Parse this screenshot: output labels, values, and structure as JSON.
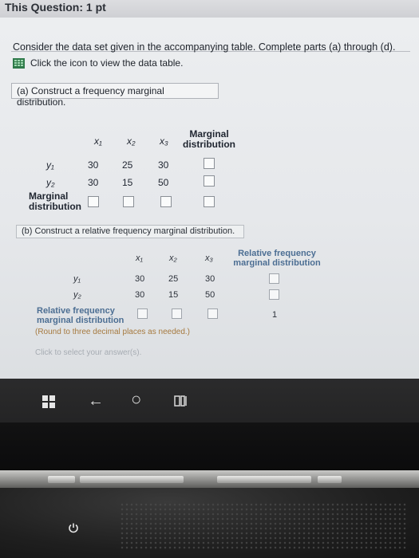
{
  "header": {
    "question_label": "This Question: 1 pt"
  },
  "intro": {
    "text": "Consider the data set given in the accompanying table. Complete parts (a) through (d).",
    "table_link": "Click the icon to view the data table."
  },
  "part_a": {
    "title": "(a) Construct a frequency marginal distribution.",
    "columns": [
      "x₁",
      "x₂",
      "x₃"
    ],
    "marginal_header_1": "Marginal",
    "marginal_header_2": "distribution",
    "rows": [
      {
        "label": "y₁",
        "values": [
          "30",
          "25",
          "30"
        ]
      },
      {
        "label": "y₂",
        "values": [
          "30",
          "15",
          "50"
        ]
      }
    ],
    "marginal_row_1": "Marginal",
    "marginal_row_2": "distribution"
  },
  "part_b": {
    "title": "(b) Construct a relative frequency marginal distribution.",
    "columns": [
      "x₁",
      "x₂",
      "x₃"
    ],
    "rf_header_1": "Relative frequency",
    "rf_header_2": "marginal distribution",
    "rows": [
      {
        "label": "y₁",
        "values": [
          "30",
          "25",
          "30"
        ]
      },
      {
        "label": "y₂",
        "values": [
          "30",
          "15",
          "50"
        ]
      }
    ],
    "rf_row_1": "Relative frequency",
    "rf_row_2": "marginal distribution",
    "total": "1",
    "round_note": "(Round to three decimal places as needed.)",
    "answer_prompt": "Click to select your answer(s)."
  },
  "taskbar": {
    "icons": [
      "windows-icon",
      "back-arrow-icon",
      "cortana-circle-icon",
      "task-view-icon"
    ],
    "back_glyph": "←",
    "circle_glyph": "○"
  }
}
